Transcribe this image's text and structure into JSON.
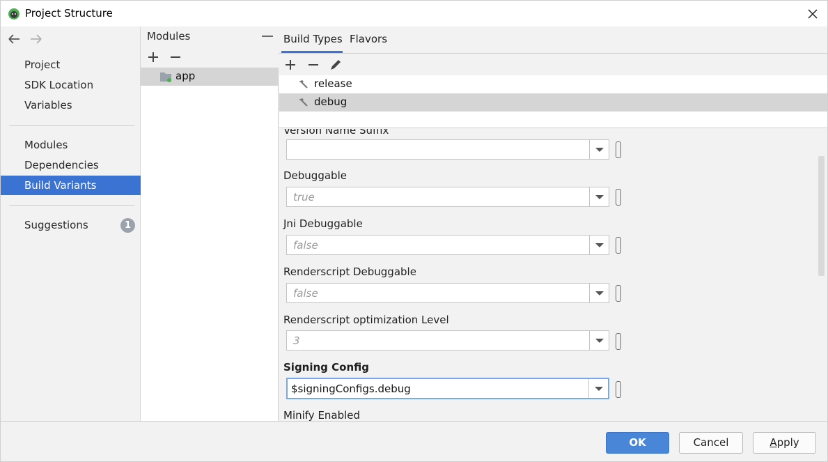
{
  "window": {
    "title": "Project Structure"
  },
  "nav": {
    "items_top": [
      {
        "label": "Project"
      },
      {
        "label": "SDK Location"
      },
      {
        "label": "Variables"
      }
    ],
    "items_mid": [
      {
        "label": "Modules"
      },
      {
        "label": "Dependencies"
      },
      {
        "label": "Build Variants"
      }
    ],
    "suggestions": {
      "label": "Suggestions",
      "count": "1"
    }
  },
  "modules": {
    "title": "Modules",
    "items": [
      {
        "label": "app"
      }
    ]
  },
  "tabs": [
    {
      "label": "Build Types"
    },
    {
      "label": "Flavors"
    }
  ],
  "build_types": [
    {
      "label": "release"
    },
    {
      "label": "debug"
    }
  ],
  "form": {
    "fields": [
      {
        "label": "Version Name Suffix",
        "value": ""
      },
      {
        "label": "Debuggable",
        "value": "true"
      },
      {
        "label": "Jni Debuggable",
        "value": "false"
      },
      {
        "label": "Renderscript Debuggable",
        "value": "false"
      },
      {
        "label": "Renderscript optimization Level",
        "value": "3"
      },
      {
        "label": "Signing Config",
        "value": "$signingConfigs.debug"
      },
      {
        "label": "Minify Enabled"
      }
    ]
  },
  "footer": {
    "ok": "OK",
    "cancel": "Cancel",
    "apply_first": "A",
    "apply_rest": "pply"
  },
  "colors": {
    "accent": "#3b73d3",
    "primary_button": "#4a86d8",
    "selected_row": "#d5d5d5"
  }
}
